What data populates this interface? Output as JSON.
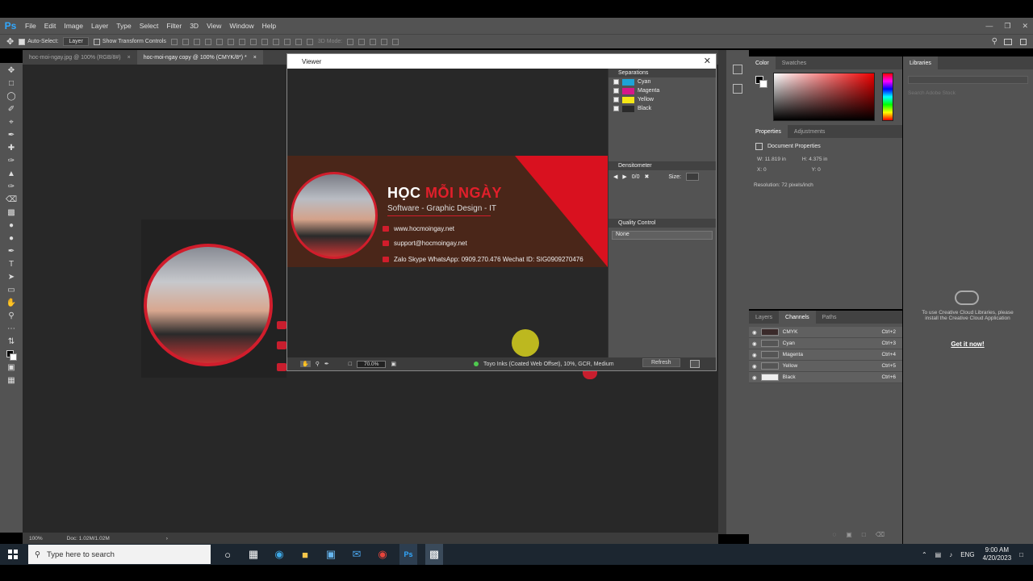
{
  "menu": {
    "logo": "Ps",
    "items": [
      "File",
      "Edit",
      "Image",
      "Layer",
      "Type",
      "Select",
      "Filter",
      "3D",
      "View",
      "Window",
      "Help"
    ]
  },
  "options": {
    "auto_select": "Auto-Select:",
    "layer_select": "Layer",
    "show_transform": "Show Transform Controls",
    "mode_3d": "3D Mode:"
  },
  "tabs": [
    {
      "label": "hoc-moi-ngay.jpg @ 100% (RGB/8#)",
      "active": false
    },
    {
      "label": "hoc-moi-ngay copy @ 100% (CMYK/8*) *",
      "active": true
    }
  ],
  "status": {
    "zoom": "100%",
    "doc": "Doc: 1.02M/1.02M"
  },
  "viewer": {
    "title": "Viewer",
    "card": {
      "brand_a": "HỌC",
      "brand_b": "MỖI NGÀY",
      "slogan": "Software - Graphic Design - IT",
      "web": "www.hocmoingay.net",
      "email": "support@hocmoingay.net",
      "contact": "Zalo Skype WhatsApp: 0909.270.476  Wechat ID: SIG0909270476"
    },
    "zoom": "70.0%",
    "profile": "Toyo Inks (Coated Web Offset), 10%, GCR, Medium",
    "refresh": "Refresh",
    "separations": {
      "title": "Separations",
      "items": [
        {
          "name": "Cyan",
          "color": "#1ea3d8"
        },
        {
          "name": "Magenta",
          "color": "#d6178a"
        },
        {
          "name": "Yellow",
          "color": "#f5e716"
        },
        {
          "name": "Black",
          "color": "#2a2a2a"
        }
      ]
    },
    "densitometer": {
      "title": "Densitometer",
      "value": "0/0",
      "size_label": "Size:"
    },
    "quality": {
      "title": "Quality Control",
      "select": "None"
    }
  },
  "color_panel": {
    "tab_color": "Color",
    "tab_swatches": "Swatches"
  },
  "properties": {
    "tab_properties": "Properties",
    "tab_adjustments": "Adjustments",
    "heading": "Document Properties",
    "w": "W: 11.819 in",
    "h": "H: 4.375 in",
    "x": "X: 0",
    "y": "Y: 0",
    "resolution": "Resolution: 72 pixels/inch"
  },
  "channels": {
    "tab_layers": "Layers",
    "tab_channels": "Channels",
    "tab_paths": "Paths",
    "rows": [
      {
        "name": "CMYK",
        "shortcut": "Ctrl+2"
      },
      {
        "name": "Cyan",
        "shortcut": "Ctrl+3"
      },
      {
        "name": "Magenta",
        "shortcut": "Ctrl+4"
      },
      {
        "name": "Yellow",
        "shortcut": "Ctrl+5"
      },
      {
        "name": "Black",
        "shortcut": "Ctrl+6"
      }
    ]
  },
  "libraries": {
    "title": "Libraries",
    "search": "Search Adobe Stock",
    "message": "To use Creative Cloud Libraries, please install the Creative Cloud Application",
    "link": "Get it now!"
  },
  "taskbar": {
    "search_placeholder": "Type here to search",
    "lang": "ENG",
    "time": "9:00 AM",
    "date": "4/20/2023"
  }
}
